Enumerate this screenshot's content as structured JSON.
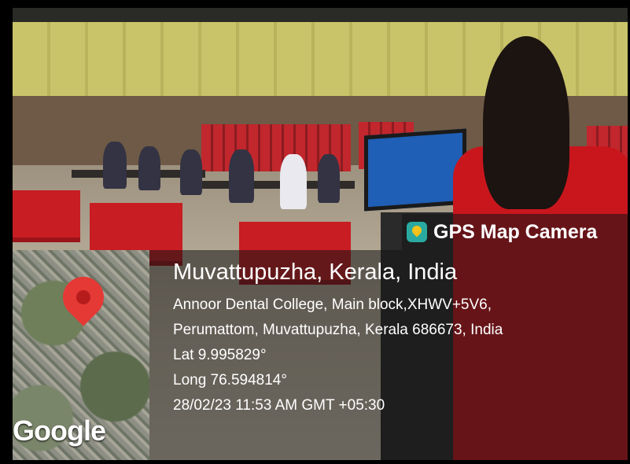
{
  "watermark": {
    "app_name": "GPS Map Camera",
    "map_logo": "Google",
    "location_title": "Muvattupuzha, Kerala, India",
    "address_line1": "Annoor Dental College, Main block,XHWV+5V6,",
    "address_line2": "Perumattom, Muvattupuzha, Kerala 686673, India",
    "latitude": "Lat 9.995829°",
    "longitude": "Long 76.594814°",
    "datetime": "28/02/23 11:53 AM GMT +05:30"
  },
  "icons": [
    "gps-map-camera-app-icon",
    "map-pin-icon"
  ],
  "colors": {
    "pin": "#e53935",
    "overlay": "rgba(20,20,20,0.55)"
  }
}
